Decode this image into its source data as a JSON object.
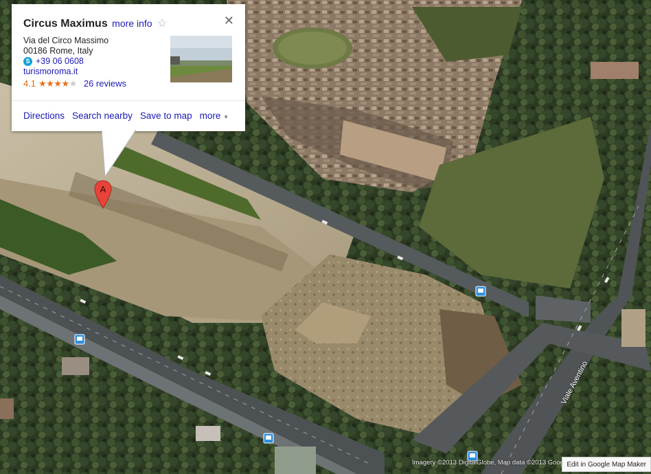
{
  "place": {
    "name": "Circus Maximus",
    "more_info_label": "more info",
    "address_line1": "Via del Circo Massimo",
    "address_line2": "00186 Rome, Italy",
    "phone": "+39 06 0608",
    "website": "turismoroma.it",
    "rating": "4.1",
    "rating_value": 4.1,
    "rating_max": 5,
    "reviews": "26 reviews"
  },
  "actions": {
    "directions": "Directions",
    "search_nearby": "Search nearby",
    "save_to_map": "Save to map",
    "more": "more"
  },
  "marker": {
    "label": "A",
    "color": "#e8433a"
  },
  "map": {
    "street_label": "Viale Aventino",
    "attribution": "Imagery ©2013 DigitalGlobe, Map data ©2013 Google",
    "mapmaker_button": "Edit in Google Map Maker"
  },
  "icons": {
    "close": "close-icon",
    "star": "favorite-star-icon",
    "phone": "skype-icon",
    "bus": "bus-stop-icon",
    "caret": "chevron-down-icon"
  },
  "colors": {
    "link": "#1a1ab5",
    "rating": "#e7711b",
    "marker": "#e8433a"
  }
}
